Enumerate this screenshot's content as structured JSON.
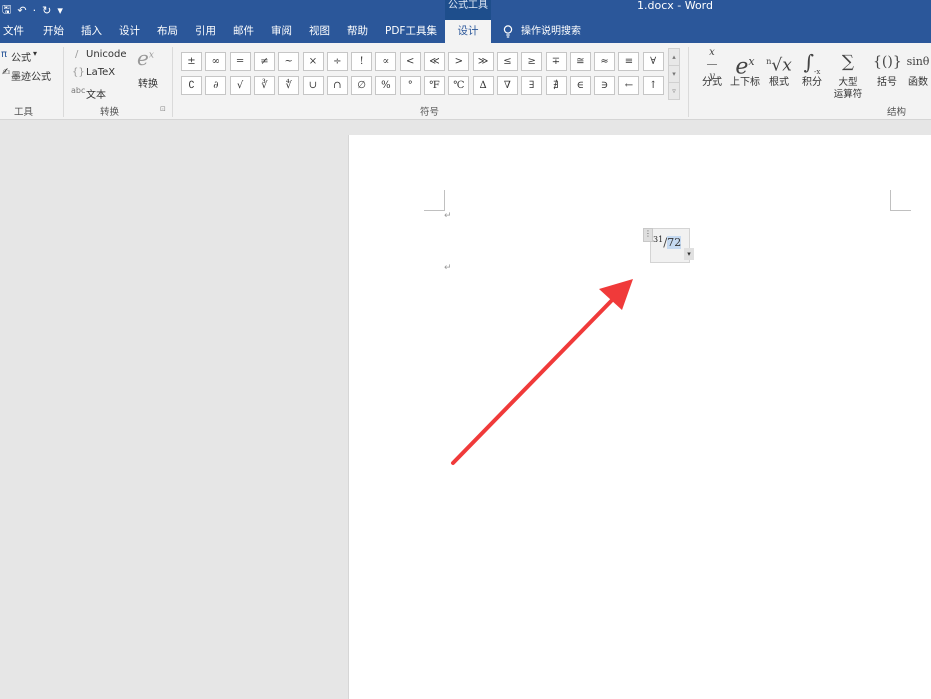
{
  "window": {
    "context_tab_group": "公式工具",
    "doc_title": "1.docx  -  Word"
  },
  "qat": {
    "save": "🖫",
    "undo": "↶",
    "dropdown": "·",
    "redo": "↻",
    "customize": "▾"
  },
  "menu": {
    "tabs": [
      "文件",
      "开始",
      "插入",
      "设计",
      "布局",
      "引用",
      "邮件",
      "审阅",
      "视图",
      "帮助",
      "PDF工具集",
      "设计"
    ],
    "active_index": 11,
    "tell_me": "操作说明搜索"
  },
  "ribbon": {
    "tools": {
      "equation": "公式",
      "equation_caret": "▾",
      "ink": "墨迹公式",
      "group_label": "工具"
    },
    "convert": {
      "unicode": "Unicode",
      "latex": "LaTeX",
      "text": "文本",
      "convert_label": "转换",
      "group_label": "转换",
      "launcher": "⊡"
    },
    "symbols": {
      "row1": [
        "±",
        "∞",
        "=",
        "≠",
        "~",
        "×",
        "÷",
        "!",
        "∝",
        "<",
        "≪",
        ">",
        "≫",
        "≤",
        "≥",
        "∓",
        "≅",
        "≈",
        "≡",
        "∀"
      ],
      "row2": [
        "∁",
        "∂",
        "√",
        "∛",
        "∜",
        "∪",
        "∩",
        "∅",
        "%",
        "°",
        "℉",
        "℃",
        "∆",
        "∇",
        "∃",
        "∄",
        "∈",
        "∋",
        "←",
        "↑"
      ],
      "group_label": "符号"
    },
    "structures": {
      "items": [
        {
          "glyph": "x/y",
          "label": "分式",
          "caret": "▾"
        },
        {
          "glyph": "eˣ",
          "label": "上下标",
          "caret": "▾"
        },
        {
          "glyph": "ⁿ√x",
          "label": "根式",
          "caret": "▾"
        },
        {
          "glyph": "∫",
          "label": "积分",
          "caret": "▾"
        },
        {
          "glyph": "∑",
          "label": "大型\n运算符",
          "caret": "▾"
        },
        {
          "glyph": "{()}",
          "label": "括号",
          "caret": "▾"
        },
        {
          "glyph": "sinθ",
          "label": "函数",
          "caret": "▾"
        }
      ],
      "group_label": "结构"
    }
  },
  "document": {
    "para_mark": "↵",
    "equation": {
      "numerator": "31",
      "slash": "/",
      "denominator": "72"
    }
  },
  "annotation": {
    "color": "#f03a3a"
  }
}
